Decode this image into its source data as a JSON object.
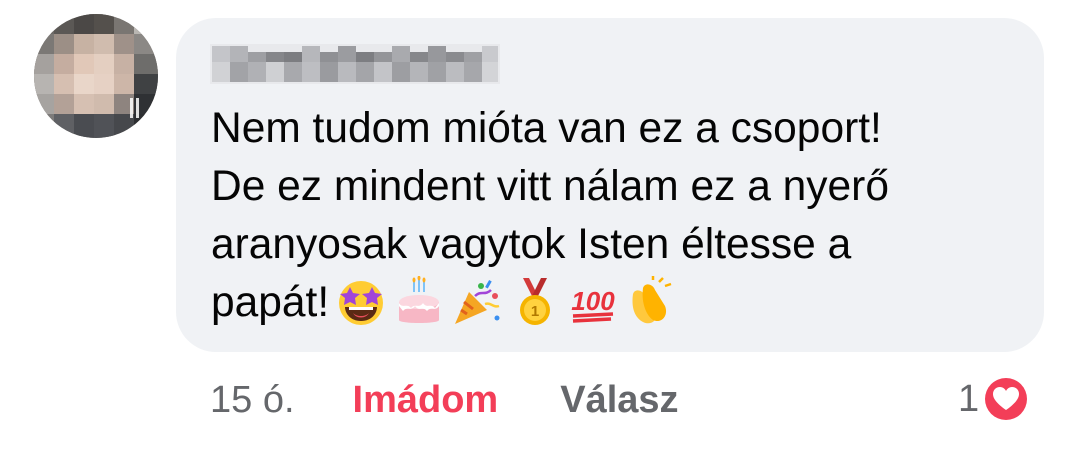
{
  "comment": {
    "lines": [
      "Nem tudom mióta van ez a csoport!",
      "De ez mindent vitt nálam ez a nyerő",
      "aranyosak vagytok Isten éltesse a",
      "papát!"
    ],
    "emojis": [
      "star-struck-emoji",
      "birthday-cake-emoji",
      "party-popper-emoji",
      "first-place-medal-emoji",
      "hundred-points-emoji",
      "clapping-hands-emoji"
    ]
  },
  "actions": {
    "time": "15 ó.",
    "love_label": "Imádom",
    "reply_label": "Válasz"
  },
  "reactions": {
    "count": "1",
    "type": "heart-icon",
    "color": "#f33e58"
  },
  "colors": {
    "bubble": "#f0f2f5",
    "text": "#050505",
    "secondary": "#65676b",
    "love": "#f33e58"
  }
}
